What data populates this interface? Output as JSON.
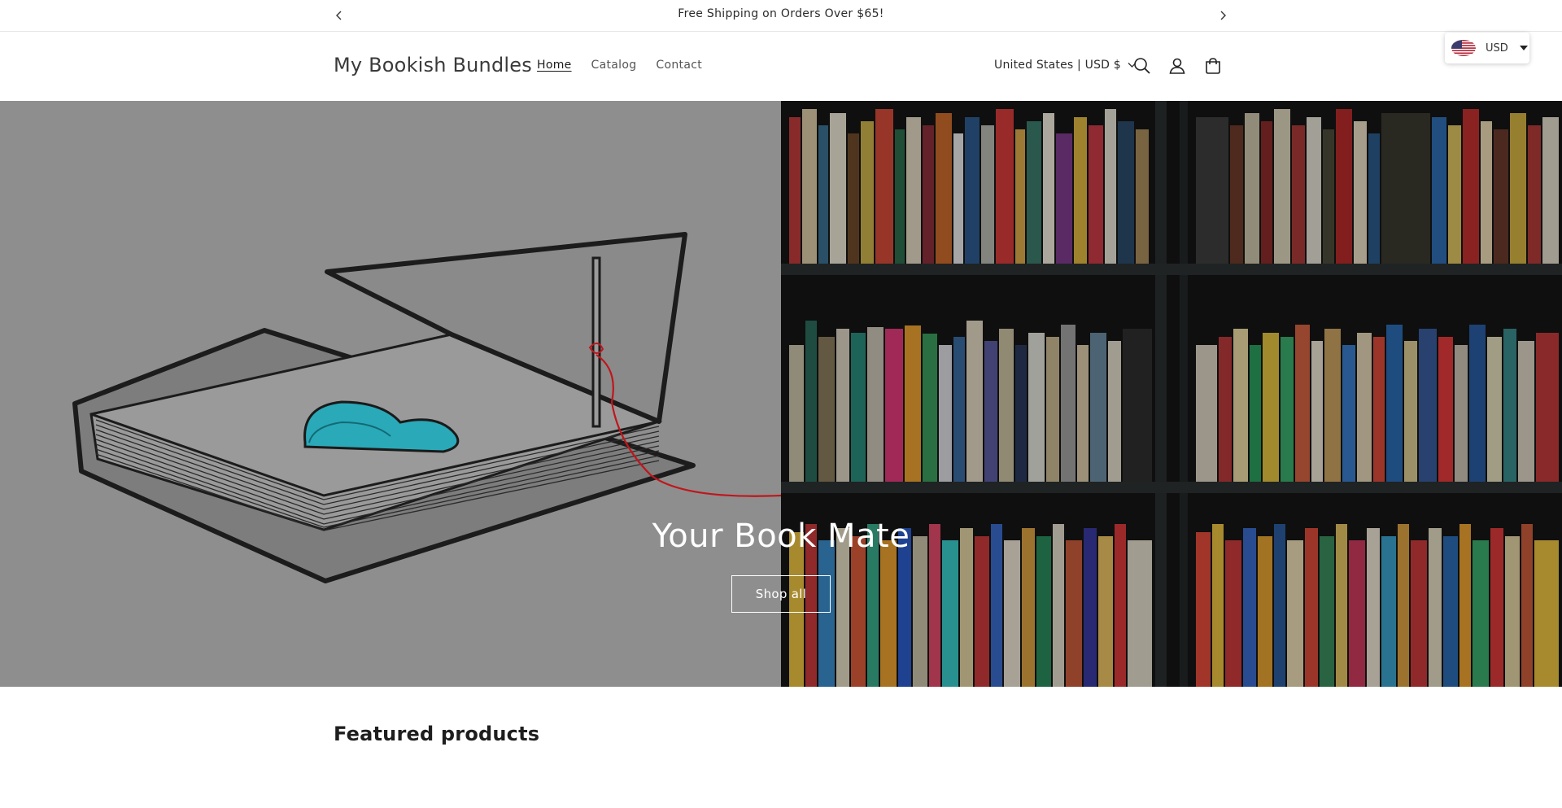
{
  "announcement": {
    "text": "Free Shipping on Orders Over $65!"
  },
  "header": {
    "logo": "My Bookish Bundles",
    "nav": [
      {
        "label": "Home",
        "active": true
      },
      {
        "label": "Catalog",
        "active": false
      },
      {
        "label": "Contact",
        "active": false
      }
    ],
    "locale": "United States | USD $",
    "icons": [
      "search-icon",
      "account-icon",
      "cart-icon"
    ]
  },
  "currency_widget": {
    "code": "USD",
    "flag": "us-flag-icon"
  },
  "hero": {
    "title": "Your Book Mate",
    "button": "Shop all"
  },
  "featured": {
    "heading": "Featured products"
  },
  "colors": {
    "hero_left_bg": "#8f8f8f",
    "hero_right_bg": "#161616",
    "heart": "#2aa9b8",
    "string": "#c0161b"
  }
}
